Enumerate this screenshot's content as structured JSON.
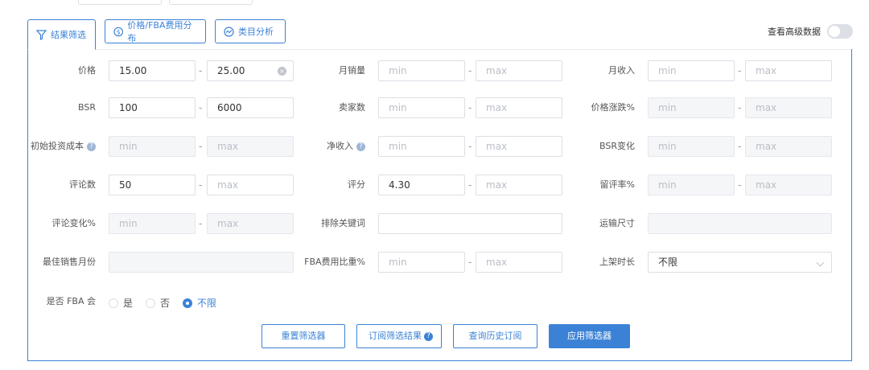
{
  "tabs": [
    {
      "label": "结果筛选",
      "icon": "filter-icon"
    },
    {
      "label": "价格/FBA费用分布",
      "icon": "dollar-circle-icon"
    },
    {
      "label": "类目分析",
      "icon": "trend-circle-icon"
    }
  ],
  "advanced": {
    "label": "查看高级数据",
    "enabled": false
  },
  "filters": {
    "price": {
      "label": "价格",
      "min": "15.00",
      "max": "25.00"
    },
    "monthly_sales": {
      "label": "月销量",
      "min_placeholder": "min",
      "max_placeholder": "max"
    },
    "monthly_revenue": {
      "label": "月收入",
      "min_placeholder": "min",
      "max_placeholder": "max"
    },
    "bsr": {
      "label": "BSR",
      "min": "100",
      "max": "6000"
    },
    "sellers": {
      "label": "卖家数",
      "min_placeholder": "min",
      "max_placeholder": "max"
    },
    "price_change": {
      "label": "价格涨跌%",
      "min_placeholder": "min",
      "max_placeholder": "max"
    },
    "initial_cost": {
      "label": "初始投资成本",
      "min_placeholder": "min",
      "max_placeholder": "max"
    },
    "net_income": {
      "label": "净收入",
      "min_placeholder": "min",
      "max_placeholder": "max"
    },
    "bsr_change": {
      "label": "BSR变化",
      "min_placeholder": "min",
      "max_placeholder": "max"
    },
    "reviews": {
      "label": "评论数",
      "min": "50",
      "max_placeholder": "max"
    },
    "rating": {
      "label": "评分",
      "min": "4.30",
      "max_placeholder": "max"
    },
    "review_rate": {
      "label": "留评率%",
      "min_placeholder": "min",
      "max_placeholder": "max"
    },
    "review_change": {
      "label": "评论变化%",
      "min_placeholder": "min",
      "max_placeholder": "max"
    },
    "exclude_keywords": {
      "label": "排除关键词",
      "value": ""
    },
    "shipping_size": {
      "label": "运输尺寸",
      "value": ""
    },
    "best_month": {
      "label": "最佳销售月份",
      "value": ""
    },
    "fba_ratio": {
      "label": "FBA费用比重%",
      "min_placeholder": "min",
      "max_placeholder": "max"
    },
    "listing_age": {
      "label": "上架时长",
      "value": "不限"
    },
    "is_fba": {
      "label": "是否 FBA 会",
      "options": [
        "是",
        "否",
        "不限"
      ],
      "selected": "不限"
    }
  },
  "buttons": {
    "reset": "重置筛选器",
    "subscribe": "订阅筛选结果",
    "history": "查询历史订阅",
    "apply": "应用筛选器"
  },
  "colors": {
    "accent": "#3b82d6",
    "border": "#dcdfe6",
    "disabled_bg": "#f5f6f8"
  }
}
